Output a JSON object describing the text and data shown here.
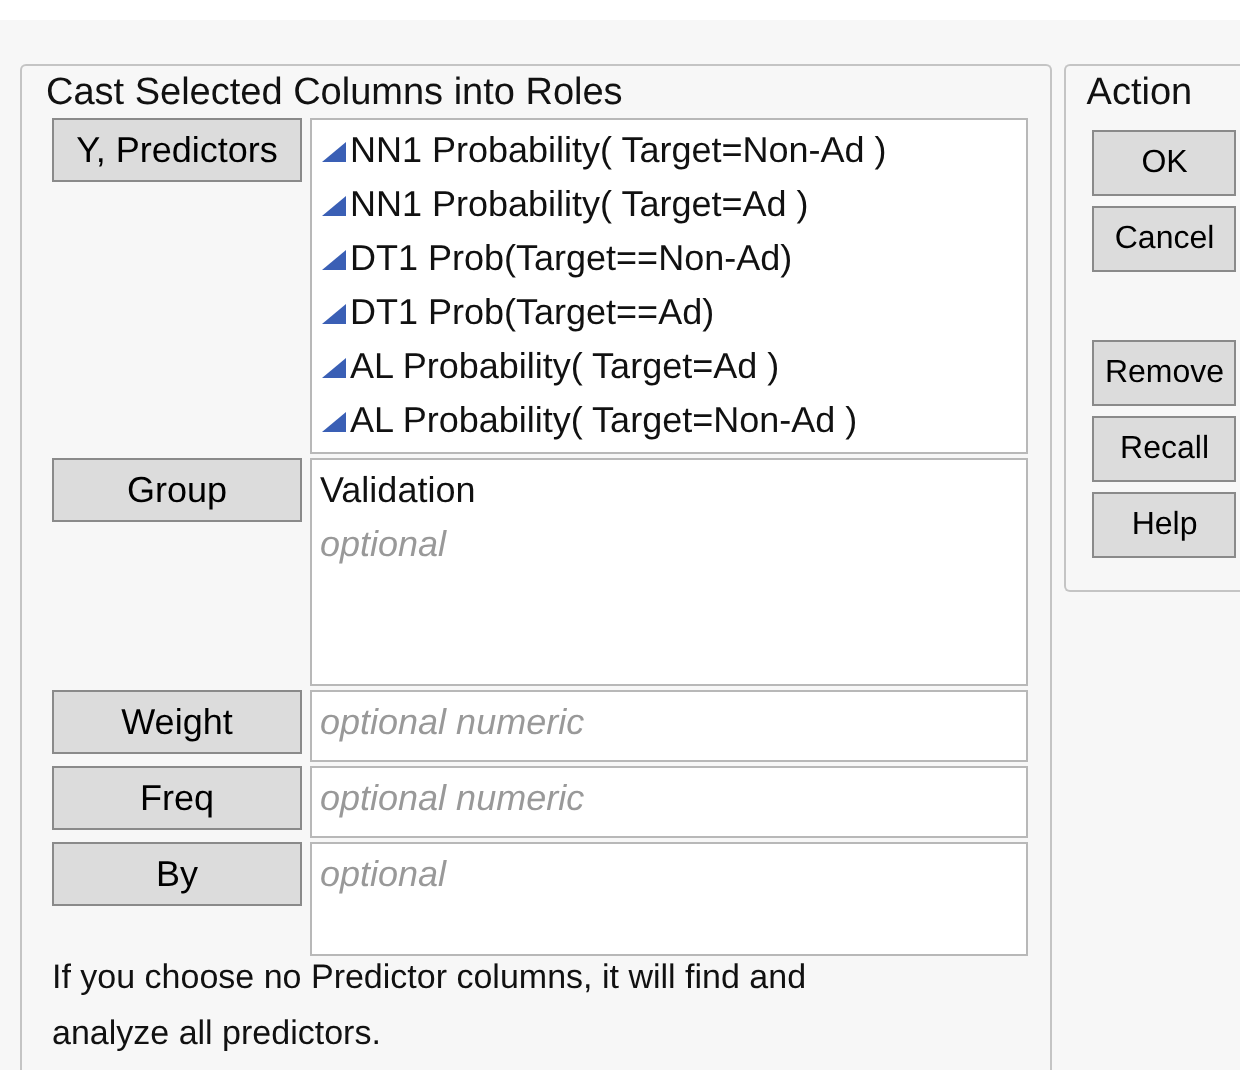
{
  "roles_panel": {
    "title": "Cast Selected Columns into Roles",
    "roles": [
      {
        "label": "Y, Predictors",
        "items": [
          {
            "text": "NN1 Probability( Target=Non-Ad )",
            "kind": "continuous"
          },
          {
            "text": "NN1 Probability( Target=Ad )",
            "kind": "continuous"
          },
          {
            "text": "DT1 Prob(Target==Non-Ad)",
            "kind": "continuous"
          },
          {
            "text": "DT1 Prob(Target==Ad)",
            "kind": "continuous"
          },
          {
            "text": "AL Probability( Target=Ad )",
            "kind": "continuous"
          },
          {
            "text": "AL Probability( Target=Non-Ad )",
            "kind": "continuous"
          }
        ]
      },
      {
        "label": "Group",
        "items": [
          {
            "text": "Validation",
            "kind": "plain"
          }
        ],
        "placeholder": "optional"
      },
      {
        "label": "Weight",
        "placeholder": "optional numeric"
      },
      {
        "label": "Freq",
        "placeholder": "optional numeric"
      },
      {
        "label": "By",
        "placeholder": "optional"
      }
    ],
    "note": "If you choose no Predictor columns, it will find and analyze all predictors."
  },
  "action_panel": {
    "title": "Action",
    "buttons": [
      {
        "label": "OK"
      },
      {
        "label": "Cancel"
      },
      {
        "label": "Remove"
      },
      {
        "label": "Recall"
      },
      {
        "label": "Help"
      }
    ]
  }
}
